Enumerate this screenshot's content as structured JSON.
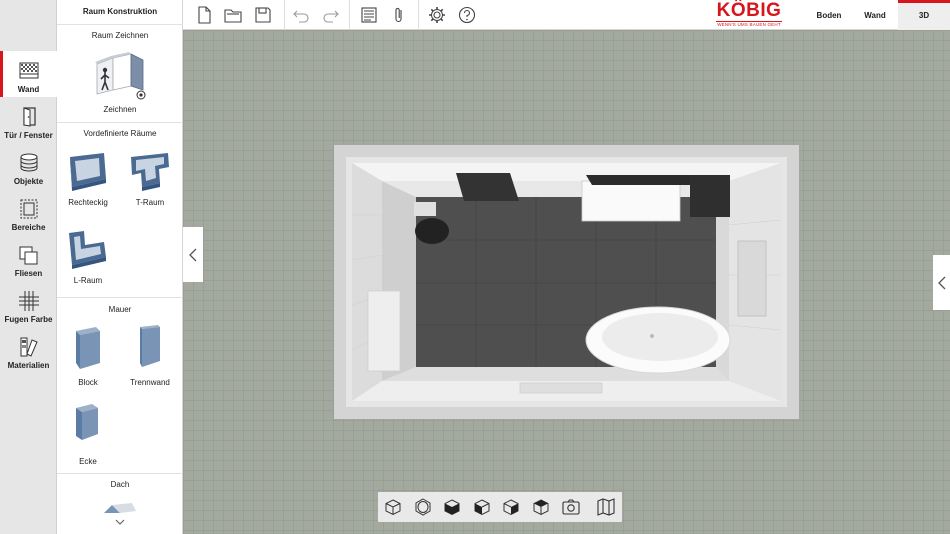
{
  "nav": {
    "items": [
      {
        "label": "Wand",
        "icon": "wall-icon"
      },
      {
        "label": "Tür / Fenster",
        "icon": "door-icon"
      },
      {
        "label": "Objekte",
        "icon": "objects-icon"
      },
      {
        "label": "Bereiche",
        "icon": "areas-icon"
      },
      {
        "label": "Fliesen",
        "icon": "tiles-icon"
      },
      {
        "label": "Fugen Farbe",
        "icon": "grout-icon"
      },
      {
        "label": "Materialien",
        "icon": "materials-icon"
      }
    ]
  },
  "panel": {
    "title": "Raum Konstruktion",
    "draw_section": "Raum Zeichnen",
    "draw_tile": "Zeichnen",
    "predefined_section": "Vordefinierte Räume",
    "rooms": [
      "Rechteckig",
      "T-Raum",
      "L-Raum"
    ],
    "wall_section": "Mauer",
    "walls": [
      "Block",
      "Trennwand",
      "Ecke"
    ],
    "roof_section": "Dach"
  },
  "toolbar": {
    "icons": [
      "new-file-icon",
      "open-folder-icon",
      "save-icon",
      "undo-icon",
      "redo-icon",
      "list-icon",
      "attachment-icon",
      "settings-icon",
      "help-icon"
    ]
  },
  "brand": {
    "name": "KÖBIG",
    "tagline": "WENN'S UMS BAUEN GEHT",
    "color": "#d7151b"
  },
  "views": {
    "tabs": [
      "Boden",
      "Wand",
      "3D"
    ],
    "active": "3D"
  },
  "viewbar": {
    "icons": [
      "cube-view-icon",
      "perspective-view-icon",
      "front-view-icon",
      "left-view-icon",
      "right-view-icon",
      "back-view-icon",
      "camera-icon",
      "floor-plan-icon"
    ]
  }
}
